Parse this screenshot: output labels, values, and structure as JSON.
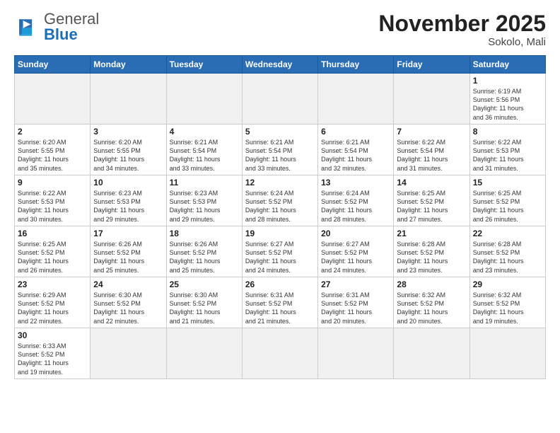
{
  "header": {
    "logo_general": "General",
    "logo_blue": "Blue",
    "month_year": "November 2025",
    "location": "Sokolo, Mali"
  },
  "weekdays": [
    "Sunday",
    "Monday",
    "Tuesday",
    "Wednesday",
    "Thursday",
    "Friday",
    "Saturday"
  ],
  "days": [
    {
      "date": 1,
      "col": 6,
      "sunrise": "6:19 AM",
      "sunset": "5:56 PM",
      "daylight": "11 hours and 36 minutes."
    },
    {
      "date": 2,
      "col": 0,
      "sunrise": "6:20 AM",
      "sunset": "5:55 PM",
      "daylight": "11 hours and 35 minutes."
    },
    {
      "date": 3,
      "col": 1,
      "sunrise": "6:20 AM",
      "sunset": "5:55 PM",
      "daylight": "11 hours and 34 minutes."
    },
    {
      "date": 4,
      "col": 2,
      "sunrise": "6:21 AM",
      "sunset": "5:54 PM",
      "daylight": "11 hours and 33 minutes."
    },
    {
      "date": 5,
      "col": 3,
      "sunrise": "6:21 AM",
      "sunset": "5:54 PM",
      "daylight": "11 hours and 33 minutes."
    },
    {
      "date": 6,
      "col": 4,
      "sunrise": "6:21 AM",
      "sunset": "5:54 PM",
      "daylight": "11 hours and 32 minutes."
    },
    {
      "date": 7,
      "col": 5,
      "sunrise": "6:22 AM",
      "sunset": "5:54 PM",
      "daylight": "11 hours and 31 minutes."
    },
    {
      "date": 8,
      "col": 6,
      "sunrise": "6:22 AM",
      "sunset": "5:53 PM",
      "daylight": "11 hours and 31 minutes."
    },
    {
      "date": 9,
      "col": 0,
      "sunrise": "6:22 AM",
      "sunset": "5:53 PM",
      "daylight": "11 hours and 30 minutes."
    },
    {
      "date": 10,
      "col": 1,
      "sunrise": "6:23 AM",
      "sunset": "5:53 PM",
      "daylight": "11 hours and 29 minutes."
    },
    {
      "date": 11,
      "col": 2,
      "sunrise": "6:23 AM",
      "sunset": "5:53 PM",
      "daylight": "11 hours and 29 minutes."
    },
    {
      "date": 12,
      "col": 3,
      "sunrise": "6:24 AM",
      "sunset": "5:52 PM",
      "daylight": "11 hours and 28 minutes."
    },
    {
      "date": 13,
      "col": 4,
      "sunrise": "6:24 AM",
      "sunset": "5:52 PM",
      "daylight": "11 hours and 28 minutes."
    },
    {
      "date": 14,
      "col": 5,
      "sunrise": "6:25 AM",
      "sunset": "5:52 PM",
      "daylight": "11 hours and 27 minutes."
    },
    {
      "date": 15,
      "col": 6,
      "sunrise": "6:25 AM",
      "sunset": "5:52 PM",
      "daylight": "11 hours and 26 minutes."
    },
    {
      "date": 16,
      "col": 0,
      "sunrise": "6:25 AM",
      "sunset": "5:52 PM",
      "daylight": "11 hours and 26 minutes."
    },
    {
      "date": 17,
      "col": 1,
      "sunrise": "6:26 AM",
      "sunset": "5:52 PM",
      "daylight": "11 hours and 25 minutes."
    },
    {
      "date": 18,
      "col": 2,
      "sunrise": "6:26 AM",
      "sunset": "5:52 PM",
      "daylight": "11 hours and 25 minutes."
    },
    {
      "date": 19,
      "col": 3,
      "sunrise": "6:27 AM",
      "sunset": "5:52 PM",
      "daylight": "11 hours and 24 minutes."
    },
    {
      "date": 20,
      "col": 4,
      "sunrise": "6:27 AM",
      "sunset": "5:52 PM",
      "daylight": "11 hours and 24 minutes."
    },
    {
      "date": 21,
      "col": 5,
      "sunrise": "6:28 AM",
      "sunset": "5:52 PM",
      "daylight": "11 hours and 23 minutes."
    },
    {
      "date": 22,
      "col": 6,
      "sunrise": "6:28 AM",
      "sunset": "5:52 PM",
      "daylight": "11 hours and 23 minutes."
    },
    {
      "date": 23,
      "col": 0,
      "sunrise": "6:29 AM",
      "sunset": "5:52 PM",
      "daylight": "11 hours and 22 minutes."
    },
    {
      "date": 24,
      "col": 1,
      "sunrise": "6:30 AM",
      "sunset": "5:52 PM",
      "daylight": "11 hours and 22 minutes."
    },
    {
      "date": 25,
      "col": 2,
      "sunrise": "6:30 AM",
      "sunset": "5:52 PM",
      "daylight": "11 hours and 21 minutes."
    },
    {
      "date": 26,
      "col": 3,
      "sunrise": "6:31 AM",
      "sunset": "5:52 PM",
      "daylight": "11 hours and 21 minutes."
    },
    {
      "date": 27,
      "col": 4,
      "sunrise": "6:31 AM",
      "sunset": "5:52 PM",
      "daylight": "11 hours and 20 minutes."
    },
    {
      "date": 28,
      "col": 5,
      "sunrise": "6:32 AM",
      "sunset": "5:52 PM",
      "daylight": "11 hours and 20 minutes."
    },
    {
      "date": 29,
      "col": 6,
      "sunrise": "6:32 AM",
      "sunset": "5:52 PM",
      "daylight": "11 hours and 19 minutes."
    },
    {
      "date": 30,
      "col": 0,
      "sunrise": "6:33 AM",
      "sunset": "5:52 PM",
      "daylight": "11 hours and 19 minutes."
    }
  ],
  "labels": {
    "sunrise": "Sunrise:",
    "sunset": "Sunset:",
    "daylight": "Daylight hours"
  }
}
